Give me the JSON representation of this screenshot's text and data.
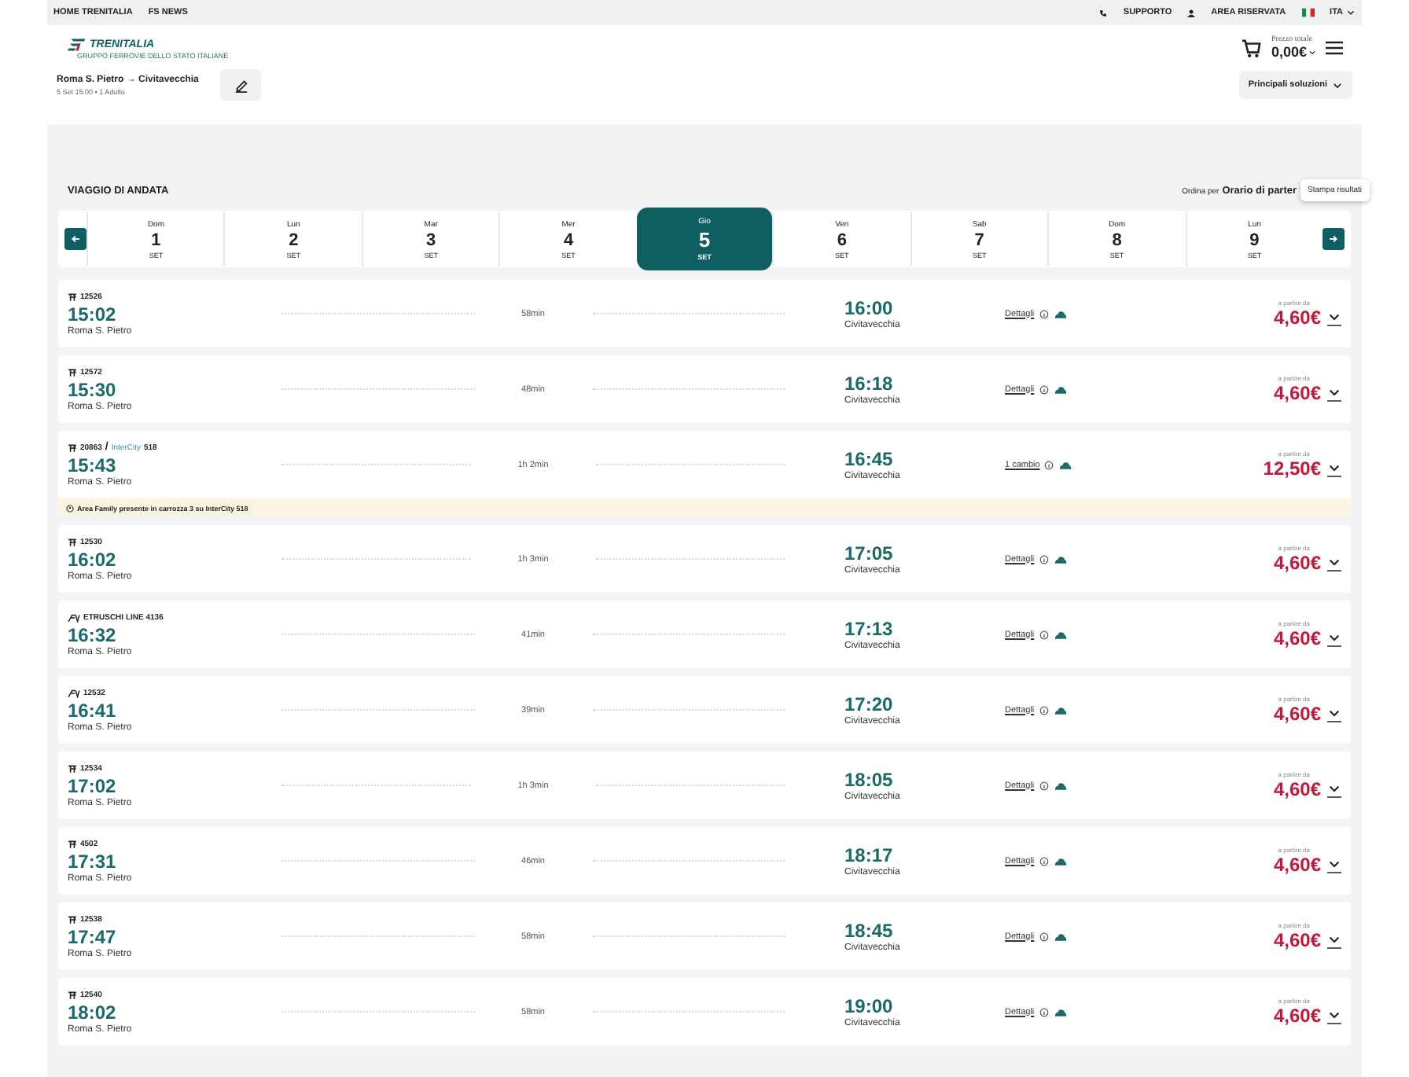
{
  "top_bar": {
    "links": [
      "HOME TRENITALIA",
      "FS NEWS"
    ],
    "support": "SUPPORTO",
    "account": "AREA RISERVATA",
    "language": "ITA"
  },
  "header": {
    "brand": "TRENITALIA",
    "brand_subtitle": "GRUPPO FERROVIE DELLO STATO ITALIANE",
    "total_label": "Prezzo totale",
    "total": "0,00€"
  },
  "search": {
    "route": "Roma S. Pietro → Civitavecchia",
    "details": "5 Set 15:00 • 1 Adulto",
    "solutions": "Principali soluzioni"
  },
  "trip": {
    "title": "VIAGGIO DI ANDATA",
    "sort_label": "Ordina per",
    "sort_value": "Orario di parter",
    "print_tooltip": "Stampa risultati"
  },
  "dates": [
    {
      "weekday": "Dom",
      "day": "1",
      "month": "SET",
      "selected": false
    },
    {
      "weekday": "Lun",
      "day": "2",
      "month": "SET",
      "selected": false
    },
    {
      "weekday": "Mar",
      "day": "3",
      "month": "SET",
      "selected": false
    },
    {
      "weekday": "Mer",
      "day": "4",
      "month": "SET",
      "selected": false
    },
    {
      "weekday": "Gio",
      "day": "5",
      "month": "SET",
      "selected": true
    },
    {
      "weekday": "Ven",
      "day": "6",
      "month": "SET",
      "selected": false
    },
    {
      "weekday": "Sab",
      "day": "7",
      "month": "SET",
      "selected": false
    },
    {
      "weekday": "Dom",
      "day": "8",
      "month": "SET",
      "selected": false
    },
    {
      "weekday": "Lun",
      "day": "9",
      "month": "SET",
      "selected": false
    }
  ],
  "solutions": [
    {
      "kind": "regionale",
      "train": "12526",
      "departure": "15:02",
      "origin": "Roma S. Pietro",
      "duration": "58min",
      "arrival": "16:00",
      "destination": "Civitavecchia",
      "details": "Dettagli",
      "price_label": "a partire da",
      "price": "4,60€"
    },
    {
      "kind": "regionale",
      "train": "12572",
      "departure": "15:30",
      "origin": "Roma S. Pietro",
      "duration": "48min",
      "arrival": "16:18",
      "destination": "Civitavecchia",
      "details": "Dettagli",
      "price_label": "a partire da",
      "price": "4,60€"
    },
    {
      "kind": "regionale",
      "train": "20863",
      "connection": {
        "separator": "/",
        "brand": "InterCity",
        "number": "518"
      },
      "departure": "15:43",
      "origin": "Roma S. Pietro",
      "duration": "1h 2min",
      "arrival": "16:45",
      "destination": "Civitavecchia",
      "details": "1 cambio",
      "price_label": "a partire da",
      "price": "12,50€",
      "notice": "Area Family presente in carrozza 3 su InterCity 518"
    },
    {
      "kind": "regionale",
      "train": "12530",
      "departure": "16:02",
      "origin": "Roma S. Pietro",
      "duration": "1h 3min",
      "arrival": "17:05",
      "destination": "Civitavecchia",
      "details": "Dettagli",
      "price_label": "a partire da",
      "price": "4,60€"
    },
    {
      "kind": "veloce",
      "train": "ETRUSCHI LINE 4136",
      "departure": "16:32",
      "origin": "Roma S. Pietro",
      "duration": "41min",
      "arrival": "17:13",
      "destination": "Civitavecchia",
      "details": "Dettagli",
      "price_label": "a partire da",
      "price": "4,60€"
    },
    {
      "kind": "veloce",
      "train": "12532",
      "departure": "16:41",
      "origin": "Roma S. Pietro",
      "duration": "39min",
      "arrival": "17:20",
      "destination": "Civitavecchia",
      "details": "Dettagli",
      "price_label": "a partire da",
      "price": "4,60€"
    },
    {
      "kind": "regionale",
      "train": "12534",
      "departure": "17:02",
      "origin": "Roma S. Pietro",
      "duration": "1h 3min",
      "arrival": "18:05",
      "destination": "Civitavecchia",
      "details": "Dettagli",
      "price_label": "a partire da",
      "price": "4,60€"
    },
    {
      "kind": "regionale",
      "train": "4502",
      "departure": "17:31",
      "origin": "Roma S. Pietro",
      "duration": "46min",
      "arrival": "18:17",
      "destination": "Civitavecchia",
      "details": "Dettagli",
      "price_label": "a partire da",
      "price": "4,60€"
    },
    {
      "kind": "regionale",
      "train": "12538",
      "departure": "17:47",
      "origin": "Roma S. Pietro",
      "duration": "58min",
      "arrival": "18:45",
      "destination": "Civitavecchia",
      "details": "Dettagli",
      "price_label": "a partire da",
      "price": "4,60€"
    },
    {
      "kind": "regionale",
      "train": "12540",
      "departure": "18:02",
      "origin": "Roma S. Pietro",
      "duration": "58min",
      "arrival": "19:00",
      "destination": "Civitavecchia",
      "details": "Dettagli",
      "price_label": "a partire da",
      "price": "4,60€"
    }
  ]
}
